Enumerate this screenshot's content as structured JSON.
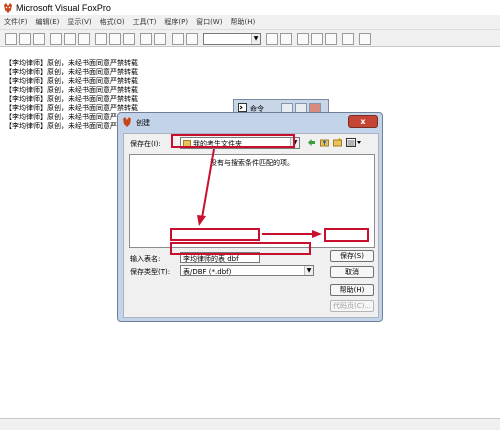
{
  "app": {
    "title": "Microsoft Visual FoxPro"
  },
  "menu": [
    "文件(F)",
    "编辑(E)",
    "显示(V)",
    "格式(O)",
    "工具(T)",
    "程序(P)",
    "窗口(W)",
    "帮助(H)"
  ],
  "content": {
    "lines": [
      "【李均律师】原创，未经书面同意严禁转载",
      "【李均律师】原创，未经书面同意严禁转载",
      "【李均律师】原创，未经书面同意严禁转载",
      "【李均律师】原创，未经书面同意严禁转载",
      "【李均律师】原创，未经书面同意严禁转载",
      "【李均律师】原创，未经书面同意严禁转载",
      "【李均律师】原创，未经书面同意严禁转载",
      "【李均律师】原创，未经书面同意严禁转载"
    ]
  },
  "command_window": {
    "title": "命令"
  },
  "dialog": {
    "title": "创建",
    "close_label": "x",
    "save_in_label": "保存在(I):",
    "save_in_value": "我的考生文件夹",
    "empty_message": "没有与搜索条件匹配的项。",
    "table_name_label": "输入表名:",
    "table_name_value": "李均律师的表 dbf",
    "save_type_label": "保存类型(T):",
    "save_type_value": "表/DBF (*.dbf)",
    "buttons": {
      "save": "保存(S)",
      "cancel": "取消",
      "help": "帮助(H)",
      "code_page": "代码页(C)..."
    }
  },
  "colors": {
    "highlight": "#c8102e",
    "dialog_frame": "#c2d3ea"
  }
}
